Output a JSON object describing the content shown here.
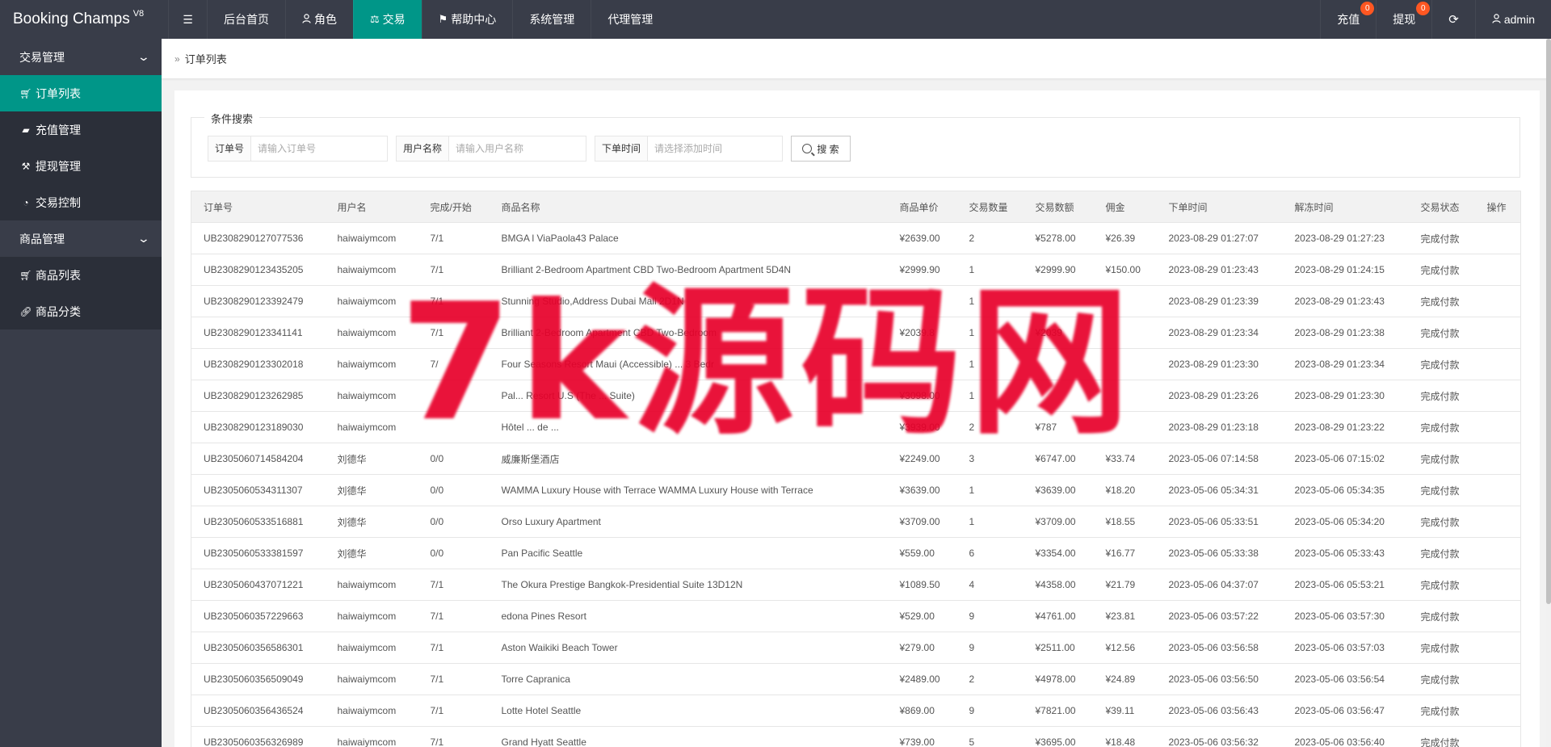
{
  "app": {
    "name": "Booking Champs",
    "version": "V8"
  },
  "topnav": {
    "toggle_icon": "menu-icon",
    "items": [
      {
        "label": "后台首页",
        "icon": ""
      },
      {
        "label": "角色",
        "icon": "user-icon"
      },
      {
        "label": "交易",
        "icon": "scale-icon",
        "active": true
      },
      {
        "label": "帮助中心",
        "icon": "flag-icon"
      },
      {
        "label": "系统管理",
        "icon": ""
      },
      {
        "label": "代理管理",
        "icon": ""
      }
    ],
    "right": {
      "recharge": {
        "label": "充值",
        "badge": "0"
      },
      "withdraw": {
        "label": "提现",
        "badge": "0"
      },
      "refresh_icon": "refresh-icon",
      "user": "admin"
    }
  },
  "sidebar": {
    "groups": [
      {
        "label": "交易管理",
        "items": [
          {
            "label": "订单列表",
            "icon": "cart-icon",
            "active": true
          },
          {
            "label": "充值管理",
            "icon": "chat-icon"
          },
          {
            "label": "提现管理",
            "icon": "hammer-icon"
          },
          {
            "label": "交易控制",
            "icon": "gauge-icon"
          }
        ]
      },
      {
        "label": "商品管理",
        "items": [
          {
            "label": "商品列表",
            "icon": "cart-icon"
          },
          {
            "label": "商品分类",
            "icon": "link-icon"
          }
        ]
      }
    ]
  },
  "breadcrumb": {
    "current": "订单列表"
  },
  "search": {
    "legend": "条件搜索",
    "order_no": {
      "label": "订单号",
      "placeholder": "请输入订单号",
      "value": ""
    },
    "username": {
      "label": "用户名称",
      "placeholder": "请输入用户名称",
      "value": ""
    },
    "order_time": {
      "label": "下单时间",
      "placeholder": "请选择添加时间",
      "value": ""
    },
    "button": "搜 索"
  },
  "table": {
    "columns": [
      "订单号",
      "用户名",
      "完成/开始",
      "商品名称",
      "商品单价",
      "交易数量",
      "交易数额",
      "佣金",
      "下单时间",
      "解冻时间",
      "交易状态",
      "操作"
    ],
    "rows": [
      [
        "UB2308290127077536",
        "haiwaiymcom",
        "7/1",
        "BMGA l ViaPaola43 Palace",
        "¥2639.00",
        "2",
        "¥5278.00",
        "¥26.39",
        "2023-08-29 01:27:07",
        "2023-08-29 01:27:23",
        "完成付款",
        ""
      ],
      [
        "UB2308290123435205",
        "haiwaiymcom",
        "7/1",
        "Brilliant 2-Bedroom Apartment CBD Two-Bedroom Apartment 5D4N",
        "¥2999.90",
        "1",
        "¥2999.90",
        "¥150.00",
        "2023-08-29 01:23:43",
        "2023-08-29 01:24:15",
        "完成付款",
        ""
      ],
      [
        "UB2308290123392479",
        "haiwaiymcom",
        "7/1",
        "Stunning Studio,Address Dubai Mall 2D1N",
        "",
        "1",
        "",
        "",
        "2023-08-29 01:23:39",
        "2023-08-29 01:23:43",
        "完成付款",
        ""
      ],
      [
        "UB2308290123341141",
        "haiwaiymcom",
        "7/1",
        "Brilliant 2-Bedroom Apartment CBD Two-Bedroom",
        "¥2039.8",
        "1",
        "¥2039",
        "",
        "2023-08-29 01:23:34",
        "2023-08-29 01:23:38",
        "完成付款",
        ""
      ],
      [
        "UB2308290123302018",
        "haiwaiymcom",
        "7/",
        "Four Seasons Resort Maui (Accessible) ... 3 Bedr",
        "",
        "1",
        "",
        "",
        "2023-08-29 01:23:30",
        "2023-08-29 01:23:34",
        "完成付款",
        ""
      ],
      [
        "UB2308290123262985",
        "haiwaiymcom",
        "",
        "Pal... Resort U.S (The ... Suite)",
        "¥3098.00",
        "1",
        "",
        "",
        "2023-08-29 01:23:26",
        "2023-08-29 01:23:30",
        "完成付款",
        ""
      ],
      [
        "UB2308290123189030",
        "haiwaiymcom",
        "",
        "Hôtel ... de ...",
        "¥3939.00",
        "2",
        "¥787",
        "",
        "2023-08-29 01:23:18",
        "2023-08-29 01:23:22",
        "完成付款",
        ""
      ],
      [
        "UB2305060714584204",
        "刘德华",
        "0/0",
        "威廉斯堡酒店",
        "¥2249.00",
        "3",
        "¥6747.00",
        "¥33.74",
        "2023-05-06 07:14:58",
        "2023-05-06 07:15:02",
        "完成付款",
        ""
      ],
      [
        "UB2305060534311307",
        "刘德华",
        "0/0",
        "WAMMA Luxury House with Terrace WAMMA Luxury House with Terrace",
        "¥3639.00",
        "1",
        "¥3639.00",
        "¥18.20",
        "2023-05-06 05:34:31",
        "2023-05-06 05:34:35",
        "完成付款",
        ""
      ],
      [
        "UB2305060533516881",
        "刘德华",
        "0/0",
        "Orso Luxury Apartment",
        "¥3709.00",
        "1",
        "¥3709.00",
        "¥18.55",
        "2023-05-06 05:33:51",
        "2023-05-06 05:34:20",
        "完成付款",
        ""
      ],
      [
        "UB2305060533381597",
        "刘德华",
        "0/0",
        "Pan Pacific Seattle",
        "¥559.00",
        "6",
        "¥3354.00",
        "¥16.77",
        "2023-05-06 05:33:38",
        "2023-05-06 05:33:43",
        "完成付款",
        ""
      ],
      [
        "UB2305060437071221",
        "haiwaiymcom",
        "7/1",
        "The Okura Prestige Bangkok-Presidential Suite 13D12N",
        "¥1089.50",
        "4",
        "¥4358.00",
        "¥21.79",
        "2023-05-06 04:37:07",
        "2023-05-06 05:53:21",
        "完成付款",
        ""
      ],
      [
        "UB2305060357229663",
        "haiwaiymcom",
        "7/1",
        "edona Pines Resort",
        "¥529.00",
        "9",
        "¥4761.00",
        "¥23.81",
        "2023-05-06 03:57:22",
        "2023-05-06 03:57:30",
        "完成付款",
        ""
      ],
      [
        "UB2305060356586301",
        "haiwaiymcom",
        "7/1",
        "Aston Waikiki Beach Tower",
        "¥279.00",
        "9",
        "¥2511.00",
        "¥12.56",
        "2023-05-06 03:56:58",
        "2023-05-06 03:57:03",
        "完成付款",
        ""
      ],
      [
        "UB2305060356509049",
        "haiwaiymcom",
        "7/1",
        "Torre Capranica",
        "¥2489.00",
        "2",
        "¥4978.00",
        "¥24.89",
        "2023-05-06 03:56:50",
        "2023-05-06 03:56:54",
        "完成付款",
        ""
      ],
      [
        "UB2305060356436524",
        "haiwaiymcom",
        "7/1",
        "Lotte Hotel Seattle",
        "¥869.00",
        "9",
        "¥7821.00",
        "¥39.11",
        "2023-05-06 03:56:43",
        "2023-05-06 03:56:47",
        "完成付款",
        ""
      ],
      [
        "UB2305060356326989",
        "haiwaiymcom",
        "7/1",
        "Grand Hyatt Seattle",
        "¥739.00",
        "5",
        "¥3695.00",
        "¥18.48",
        "2023-05-06 03:56:32",
        "2023-05-06 03:56:40",
        "完成付款",
        ""
      ]
    ]
  },
  "watermark": "7k源码网",
  "colors": {
    "header": "#393d49",
    "accent": "#009688",
    "badge": "#ff5722",
    "watermark": "#e8002a"
  }
}
